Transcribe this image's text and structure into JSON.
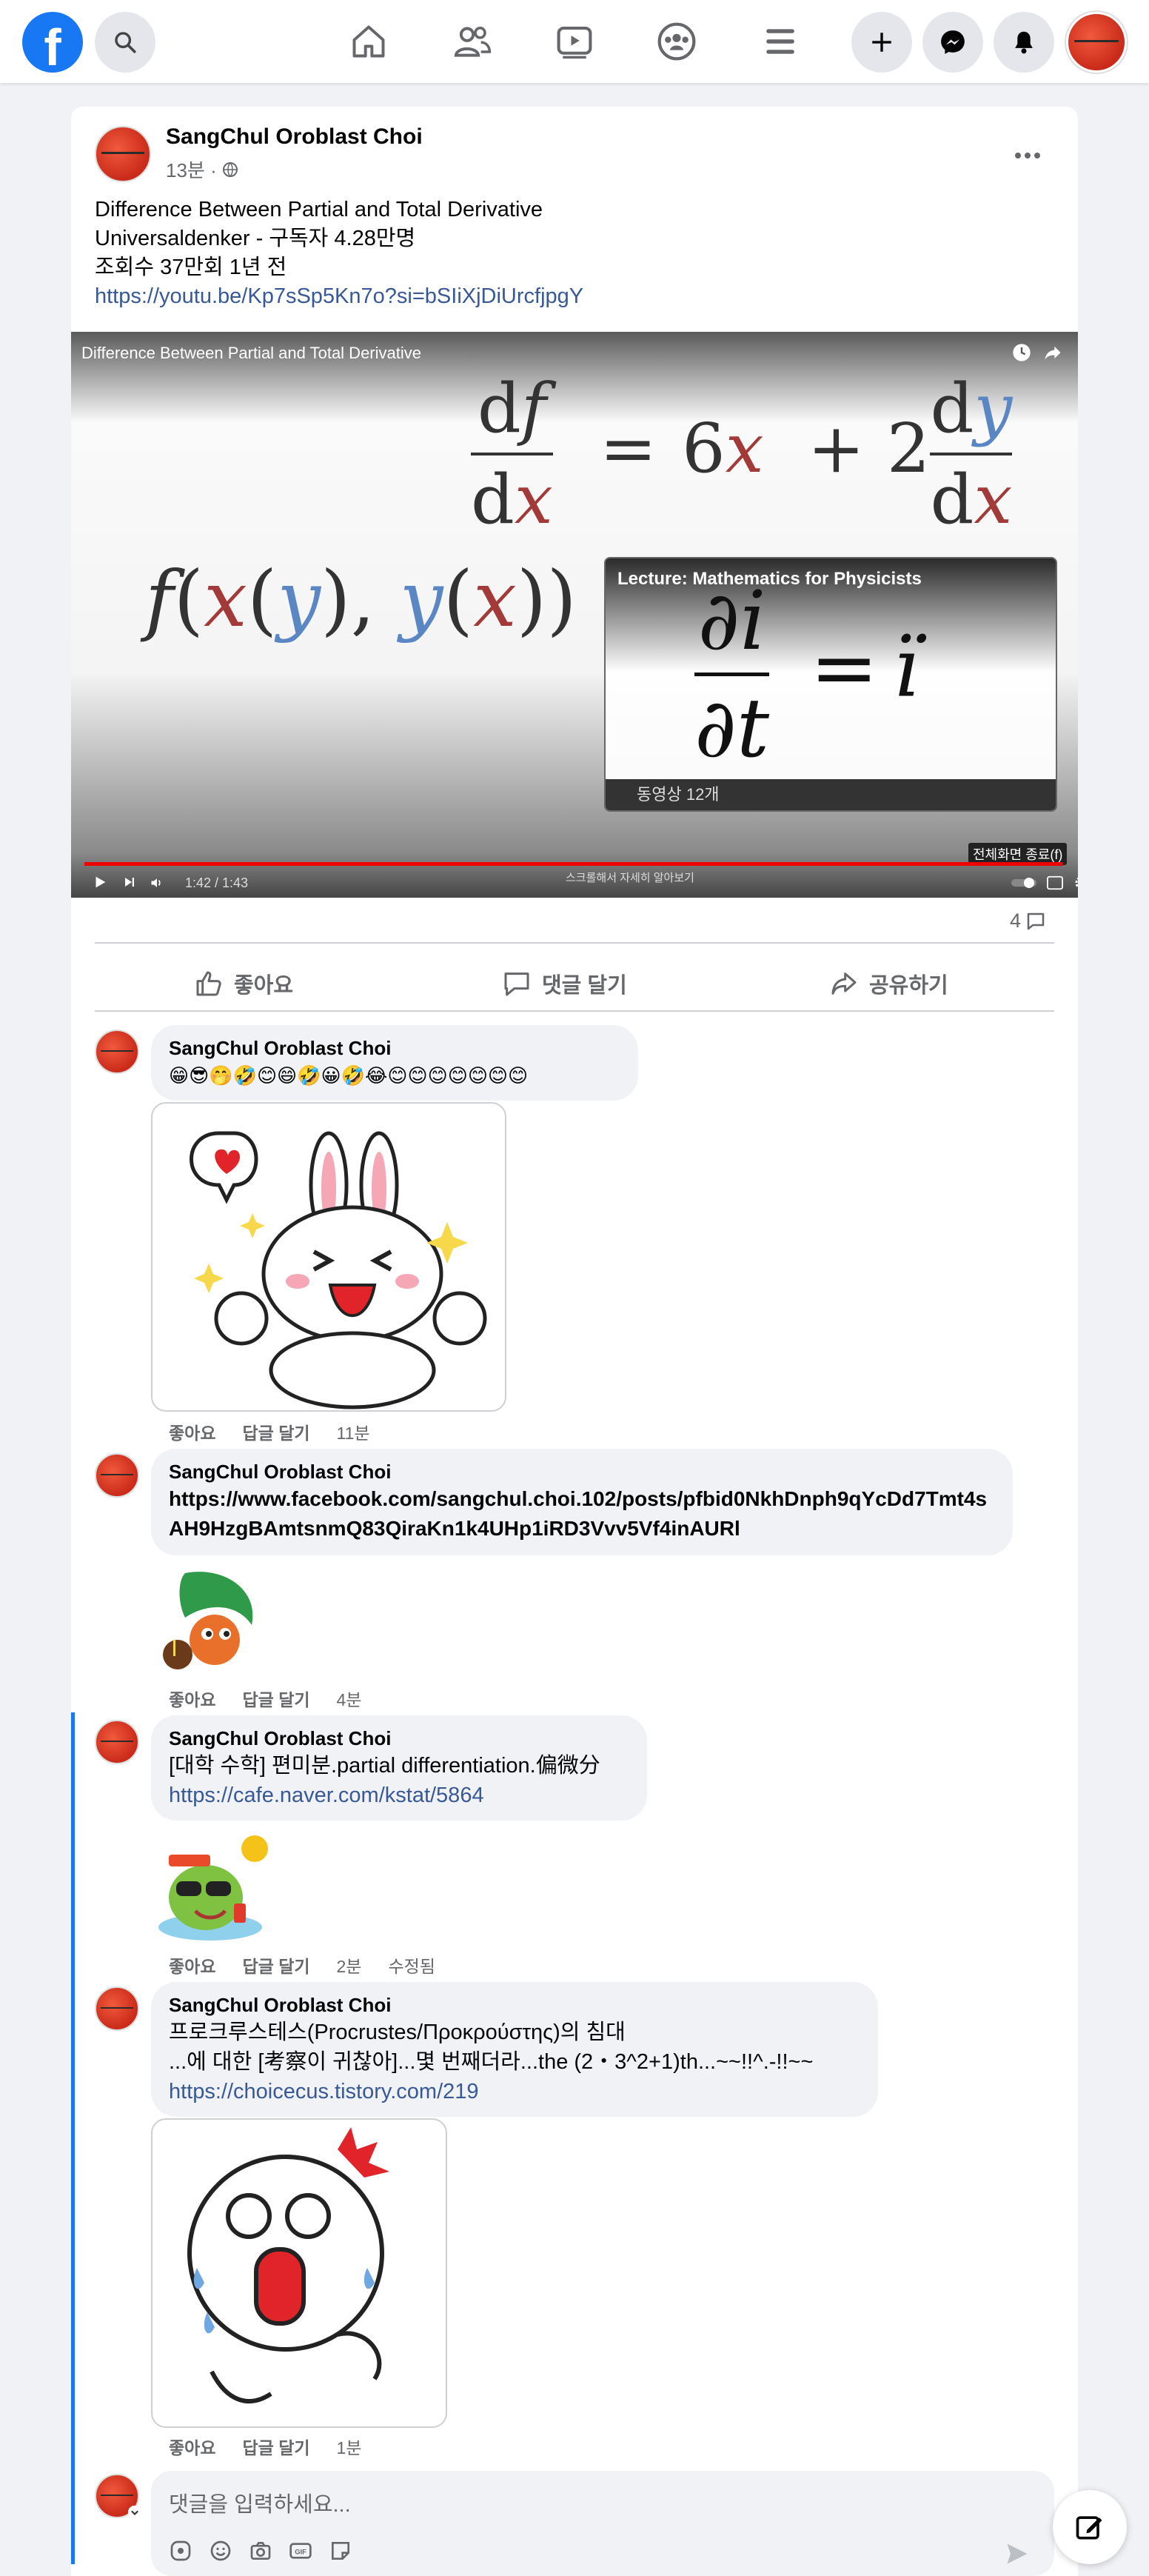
{
  "topbar": {
    "logo": "f",
    "icons": [
      "search-icon",
      "home-icon",
      "friends-icon",
      "watch-icon",
      "groups-icon",
      "menu-icon",
      "create-icon",
      "messenger-icon",
      "notifications-icon",
      "profile-avatar"
    ]
  },
  "post": {
    "author": "SangChul Oroblast Choi",
    "time": "13분 ·",
    "text_line1": "Difference Between Partial and Total Derivative",
    "text_line2": "Universaldenker - 구독자 4.28만명",
    "text_line3": "조회수 37만회  1년 전",
    "link": "https://youtu.be/Kp7sSp5Kn7o?si=bSIiXjDiUrcfjpgY",
    "video": {
      "title": "Difference Between Partial and Total Derivative",
      "playlist_title": "Lecture: Mathematics for Physicists",
      "playlist_count": "동영상 12개",
      "fullscreen_tag": "전체화면 종료(f)",
      "time": "1:42 / 1:43",
      "scroll_hint": "스크롤해서 자세히 알아보기"
    },
    "comment_count": "4",
    "actions": {
      "like": "좋아요",
      "comment": "댓글 달기",
      "share": "공유하기"
    }
  },
  "comments": [
    {
      "name": "SangChul Oroblast Choi",
      "text": "😁😎🤭🤣😊😄🤣😀🤣😂😊😊😊😊😊😊😊",
      "like": "좋아요",
      "reply": "답글 달기",
      "time": "11분"
    },
    {
      "name": "SangChul Oroblast Choi",
      "text": "https://www.facebook.com/sangchul.choi.102/posts/pfbid0NkhDnph9qYcDd7Tmt4sAH9HzgBAmtsnmQ83QiraKn1k4UHp1iRD3Vvv5Vf4inAURl",
      "like": "좋아요",
      "reply": "답글 달기",
      "time": "4분"
    },
    {
      "name": "SangChul Oroblast Choi",
      "text": "[대학 수학] 편미분.partial differentiation.偏微分",
      "link": "https://cafe.naver.com/kstat/5864",
      "like": "좋아요",
      "reply": "답글 달기",
      "time": "2분",
      "edited": "수정됨"
    },
    {
      "name": "SangChul Oroblast Choi",
      "text": "프로크루스테스(Procrustes/Προκρούστης)의 침대",
      "text2": "...에 대한 [考察이 귀찮아]...몇 번째더라...the (2・3^2+1)th...~~!!^.-!!~~",
      "link": "https://choicecus.tistory.com/219",
      "like": "좋아요",
      "reply": "답글 달기",
      "time": "1분"
    }
  ],
  "composer": {
    "placeholder": "댓글을 입력하세요..."
  },
  "colors": {
    "brand": "#1877f2",
    "link": "#385898",
    "muted": "#65676b"
  }
}
